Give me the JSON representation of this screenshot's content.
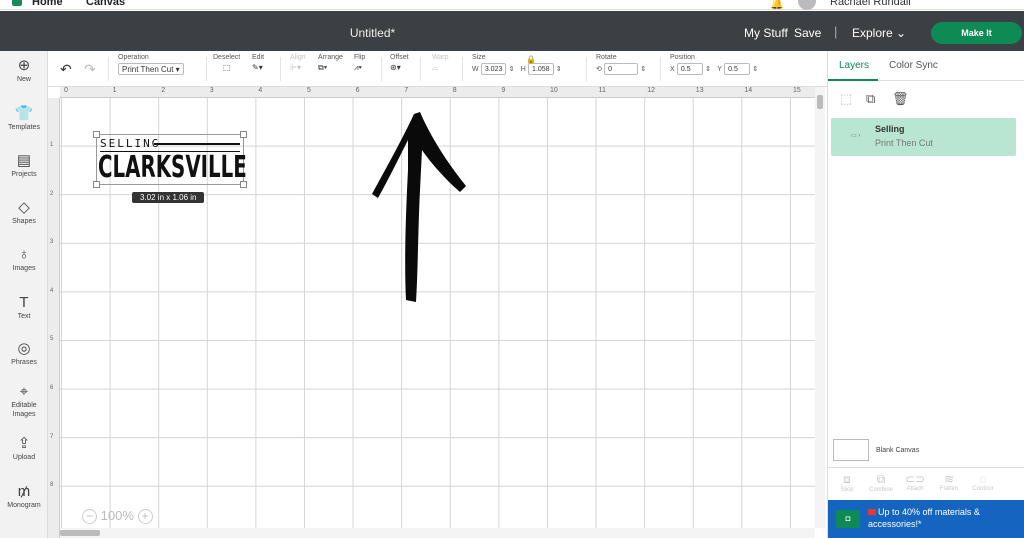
{
  "tabs": {
    "home": "Home",
    "canvas": "Canvas"
  },
  "user": {
    "name": "Rachael Rundall"
  },
  "header": {
    "title": "Untitled*",
    "my_stuff": "My Stuff",
    "save": "Save",
    "separator": "|",
    "explore": "Explore",
    "make_it": "Make It"
  },
  "sidebar": [
    {
      "icon": "plus-circle-icon",
      "glyph": "⊕",
      "label": "New"
    },
    {
      "icon": "shirt-icon",
      "glyph": "👕",
      "label": "Templates"
    },
    {
      "icon": "projects-icon",
      "glyph": "▤",
      "label": "Projects"
    },
    {
      "icon": "shapes-icon",
      "glyph": "◇",
      "label": "Shapes"
    },
    {
      "icon": "bulb-icon",
      "glyph": "♁",
      "label": "Images"
    },
    {
      "icon": "text-icon",
      "glyph": "T",
      "label": "Text"
    },
    {
      "icon": "speech-bubble-icon",
      "glyph": "◎",
      "label": "Phrases"
    },
    {
      "icon": "editable-images-icon",
      "glyph": "⌖",
      "label": "Editable Images"
    },
    {
      "icon": "upload-icon",
      "glyph": "⇪",
      "label": "Upload"
    },
    {
      "icon": "monogram-icon",
      "glyph": "₥",
      "label": "Monogram"
    }
  ],
  "toolbar": {
    "operation_label": "Operation",
    "operation_value": "Print Then Cut",
    "deselect_label": "Deselect",
    "edit_label": "Edit",
    "align_label": "Align",
    "arrange_label": "Arrange",
    "flip_label": "Flip",
    "offset_label": "Offset",
    "warp_label": "Warp",
    "size_label": "Size",
    "w_label": "W",
    "w_value": "3.023",
    "h_label": "H",
    "h_value": "1.058",
    "rotate_label": "Rotate",
    "rotate_value": "0",
    "position_label": "Position",
    "x_label": "X",
    "x_value": "0.5",
    "y_label": "Y",
    "y_value": "0.5"
  },
  "ruler": {
    "top": [
      "0",
      "1",
      "2",
      "3",
      "4",
      "5",
      "6",
      "7",
      "8",
      "9",
      "10",
      "11",
      "12",
      "13",
      "14",
      "15"
    ],
    "left": [
      "1",
      "2",
      "3",
      "4",
      "5",
      "6",
      "7",
      "8"
    ]
  },
  "canvas": {
    "design_small": "SELLING",
    "design_big": "CLARKSVILLE",
    "dimensions": "3.02  in x 1.06  in",
    "zoom": "100%"
  },
  "panel": {
    "tab_layers": "Layers",
    "tab_color_sync": "Color Sync",
    "layer_name": "Selling",
    "layer_op": "Print Then Cut",
    "blank_canvas": "Blank Canvas",
    "tools": [
      "Slice",
      "Combine",
      "Attach",
      "Flatten",
      "Contour"
    ],
    "promo": "Up to 40% off materials & accessories!*"
  },
  "colors": {
    "accent": "#0e8a55",
    "header": "#3c3f44",
    "layer_selected": "#b8e6d2",
    "promo": "#1565c0"
  }
}
